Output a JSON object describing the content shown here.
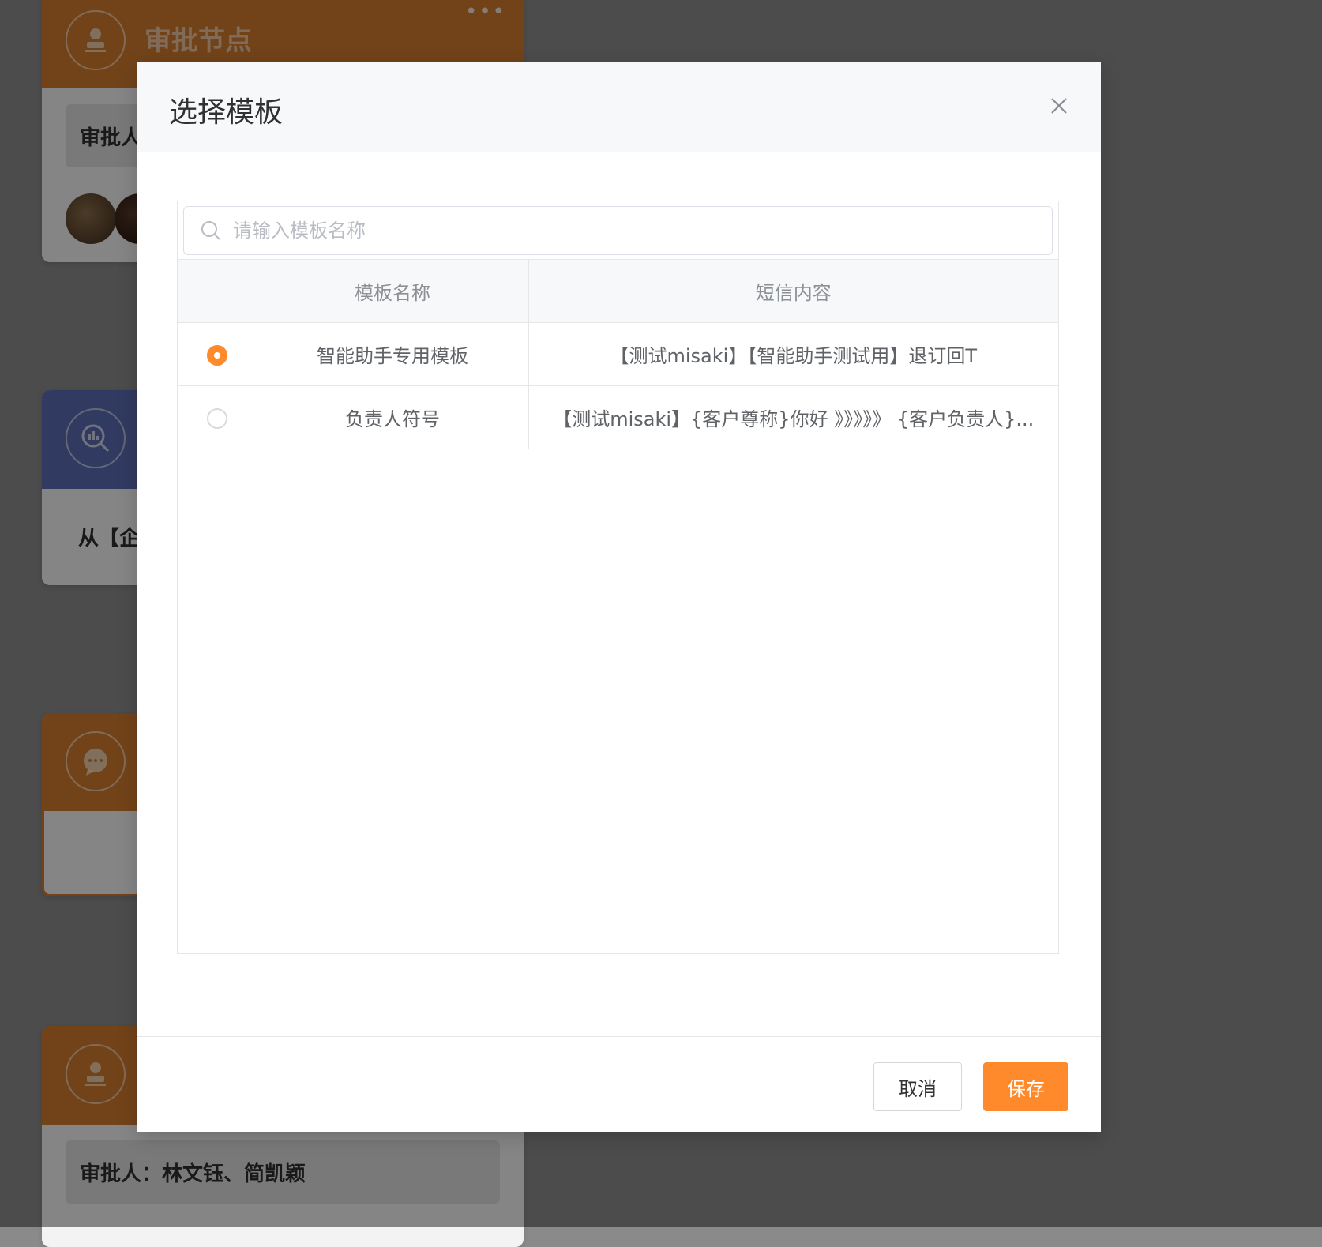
{
  "background": {
    "cards": [
      {
        "title": "审批节点",
        "more": "•••",
        "approver_box": "审批人",
        "icon": "user-stamp-icon",
        "color": "#d07a2f"
      },
      {
        "body": "从【企",
        "icon": "search-chart-icon",
        "color": "#5a6ab0"
      },
      {
        "icon": "chat-bubble-icon",
        "color": "#d07a2f"
      },
      {
        "approver_box": "审批人：林文钰、简凯颖",
        "icon": "user-stamp-icon",
        "color": "#d07a2f"
      }
    ]
  },
  "modal": {
    "title": "选择模板",
    "search": {
      "placeholder": "请输入模板名称",
      "value": ""
    },
    "table": {
      "columns": [
        "",
        "模板名称",
        "短信内容"
      ],
      "rows": [
        {
          "selected": true,
          "name": "智能助手专用模板",
          "content": "【测试misaki】【智能助手测试用】退订回T"
        },
        {
          "selected": false,
          "name": "负责人符号",
          "content": "【测试misaki】{客户尊称}你好 》》》》》 {客户负责人}..."
        }
      ]
    },
    "footer": {
      "cancel_label": "取消",
      "save_label": "保存"
    }
  },
  "colors": {
    "accent": "#ff8a2b",
    "card_orange": "#d07a2f",
    "card_blue": "#5a6ab0"
  }
}
